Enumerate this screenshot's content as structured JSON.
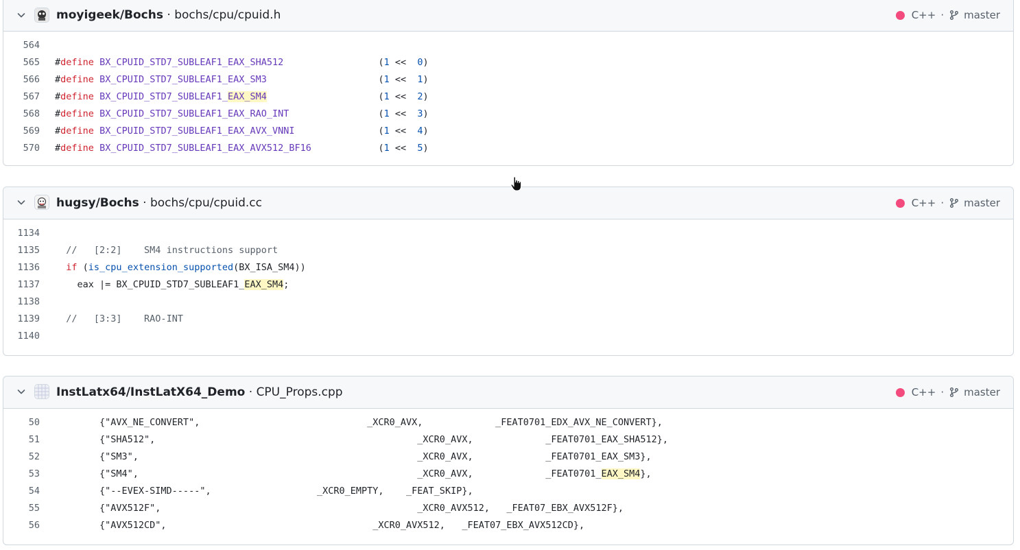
{
  "language_color": "#f34b7d",
  "highlight_color": "#fff8c5",
  "results": [
    {
      "repo": "moyigeek/Bochs",
      "path": "bochs/cpu/cpuid.h",
      "language": "C++",
      "branch": "master",
      "lines": [
        {
          "n": "564",
          "t": ""
        },
        {
          "n": "565",
          "t": "#define BX_CPUID_STD7_SUBLEAF1_EAX_SHA512                 (1 <<  0)"
        },
        {
          "n": "566",
          "t": "#define BX_CPUID_STD7_SUBLEAF1_EAX_SM3                    (1 <<  1)"
        },
        {
          "n": "567",
          "t": "#define BX_CPUID_STD7_SUBLEAF1_EAX_SM4                    (1 <<  2)"
        },
        {
          "n": "568",
          "t": "#define BX_CPUID_STD7_SUBLEAF1_EAX_RAO_INT                (1 <<  3)"
        },
        {
          "n": "569",
          "t": "#define BX_CPUID_STD7_SUBLEAF1_EAX_AVX_VNNI               (1 <<  4)"
        },
        {
          "n": "570",
          "t": "#define BX_CPUID_STD7_SUBLEAF1_EAX_AVX512_BF16            (1 <<  5)"
        }
      ]
    },
    {
      "repo": "hugsy/Bochs",
      "path": "bochs/cpu/cpuid.cc",
      "language": "C++",
      "branch": "master",
      "lines": [
        {
          "n": "1134",
          "t": ""
        },
        {
          "n": "1135",
          "t": "  //   [2:2]    SM4 instructions support"
        },
        {
          "n": "1136",
          "t": "  if (is_cpu_extension_supported(BX_ISA_SM4))"
        },
        {
          "n": "1137",
          "t": "    eax |= BX_CPUID_STD7_SUBLEAF1_EAX_SM4;"
        },
        {
          "n": "1138",
          "t": ""
        },
        {
          "n": "1139",
          "t": "  //   [3:3]    RAO-INT"
        },
        {
          "n": "1140",
          "t": ""
        }
      ]
    },
    {
      "repo": "InstLatx64/InstLatX64_Demo",
      "path": "CPU_Props.cpp",
      "language": "C++",
      "branch": "master",
      "lines": [
        {
          "n": "50",
          "t": "\t{\"AVX_NE_CONVERT\",                              _XCR0_AVX,             _FEAT0701_EDX_AVX_NE_CONVERT},"
        },
        {
          "n": "51",
          "t": "\t{\"SHA512\",                                               _XCR0_AVX,             _FEAT0701_EAX_SHA512},"
        },
        {
          "n": "52",
          "t": "\t{\"SM3\",                                                  _XCR0_AVX,             _FEAT0701_EAX_SM3},"
        },
        {
          "n": "53",
          "t": "\t{\"SM4\",                                                  _XCR0_AVX,             _FEAT0701_EAX_SM4},"
        },
        {
          "n": "54",
          "t": "\t{\"--EVEX-SIMD-----\",                   _XCR0_EMPTY,    _FEAT_SKIP},"
        },
        {
          "n": "55",
          "t": "\t{\"AVX512F\",                                              _XCR0_AVX512,   _FEAT07_EBX_AVX512F},"
        },
        {
          "n": "56",
          "t": "\t{\"AVX512CD\",                                     _XCR0_AVX512,   _FEAT07_EBX_AVX512CD},"
        }
      ]
    }
  ]
}
